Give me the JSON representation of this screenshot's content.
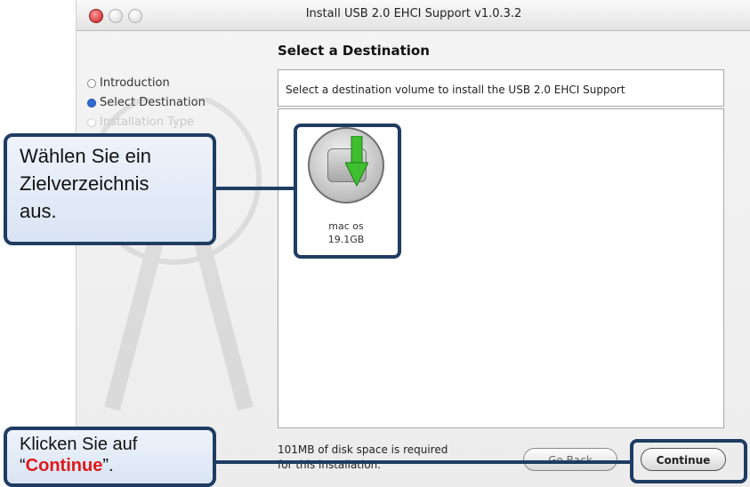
{
  "window": {
    "title": "Install USB 2.0 EHCI Support v1.0.3.2"
  },
  "steps": [
    {
      "label": "Introduction"
    },
    {
      "label": "Select Destination"
    },
    {
      "label": "Installation Type"
    }
  ],
  "pane": {
    "header": "Select a Destination",
    "subtitle": "Select a destination volume to install the USB 2.0 EHCI Support"
  },
  "volume": {
    "name": "mac os",
    "size": "19.1GB"
  },
  "footer": {
    "line1": "101MB of disk space is required",
    "line2": "for this installation."
  },
  "buttons": {
    "back": "Go Back",
    "continue": "Continue"
  },
  "callouts": {
    "select": {
      "line1": "Wählen Sie ein",
      "line2": "Zielverzeichnis",
      "line3": "aus."
    },
    "continue": {
      "line1": "Klicken Sie auf",
      "quote_open": "“",
      "keyword": "Continue",
      "quote_close": "”."
    }
  },
  "colors": {
    "accent": "#2f6bd6",
    "callout_border": "#1f3c63",
    "highlight_red": "#e01818"
  }
}
